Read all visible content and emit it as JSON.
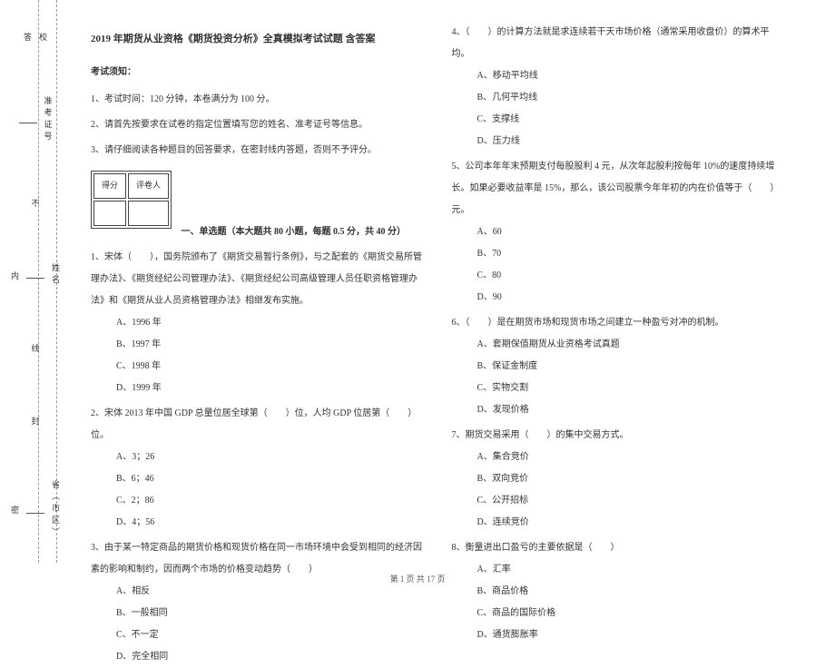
{
  "sidebar": {
    "labels": [
      "校",
      "答",
      "准考证号",
      "不",
      "姓名",
      "内",
      "线",
      "封",
      "省（市区）",
      "密"
    ]
  },
  "header": {
    "title": "2019 年期货从业资格《期货投资分析》全真模拟考试试题 含答案",
    "notice_head": "考试须知：",
    "notices": [
      "1、考试时间：120 分钟，本卷满分为 100 分。",
      "2、请首先按要求在试卷的指定位置填写您的姓名、准考证号等信息。",
      "3、请仔细阅读各种题目的回答要求，在密封线内答题，否则不予评分。"
    ],
    "score_labels": [
      "得分",
      "评卷人"
    ],
    "section1_title": "一、单选题（本大题共 80 小题，每题 0.5 分，共 40 分）"
  },
  "questions_left": [
    {
      "stem": "1、宋体（　　），国务院颁布了《期货交易暂行条例》，与之配套的《期货交易所管理办法》、《期货经纪公司管理办法》、《期货经纪公司高级管理人员任职资格管理办法》和《期货从业人员资格管理办法》相继发布实施。",
      "opts": [
        "A、1996 年",
        "B、1997 年",
        "C、1998 年",
        "D、1999 年"
      ]
    },
    {
      "stem": "2、宋体 2013 年中国 GDP 总量位居全球第（　　）位，人均 GDP 位居第（　　）位。",
      "opts": [
        "A、3；26",
        "B、6；46",
        "C、2；86",
        "D、4；56"
      ]
    },
    {
      "stem": "3、由于某一特定商品的期货价格和现货价格在同一市场环境中会受到相同的经济因素的影响和制约，因而两个市场的价格变动趋势（　　）",
      "opts": [
        "A、相反",
        "B、一般相同",
        "C、不一定",
        "D、完全相同"
      ]
    }
  ],
  "questions_right": [
    {
      "stem": "4、（　　）的计算方法就是求连续若干天市场价格（通常采用收盘价）的算术平均。",
      "opts": [
        "A、移动平均线",
        "B、几何平均线",
        "C、支撑线",
        "D、压力线"
      ]
    },
    {
      "stem": "5、公司本年年末预期支付每股股利 4 元，从次年起股利按每年 10%的速度持续增长。如果必要收益率是 15%，那么，该公司股票今年年初的内在价值等于（　　）元。",
      "opts": [
        "A、60",
        "B、70",
        "C、80",
        "D、90"
      ]
    },
    {
      "stem": "6、（　　）是在期货市场和现货市场之间建立一种盈亏对冲的机制。",
      "opts": [
        "A、套期保值期货从业资格考试真题",
        "B、保证金制度",
        "C、实物交割",
        "D、发现价格"
      ]
    },
    {
      "stem": "7、期货交易采用（　　）的集中交易方式。",
      "opts": [
        "A、集合竞价",
        "B、双向竞价",
        "C、公开招标",
        "D、连续竞价"
      ]
    },
    {
      "stem": "8、衡量进出口盈亏的主要依据是（　　）",
      "opts": [
        "A、汇率",
        "B、商品价格",
        "C、商品的国际价格",
        "D、通货膨胀率"
      ]
    }
  ],
  "footer": "第 1 页 共 17 页"
}
